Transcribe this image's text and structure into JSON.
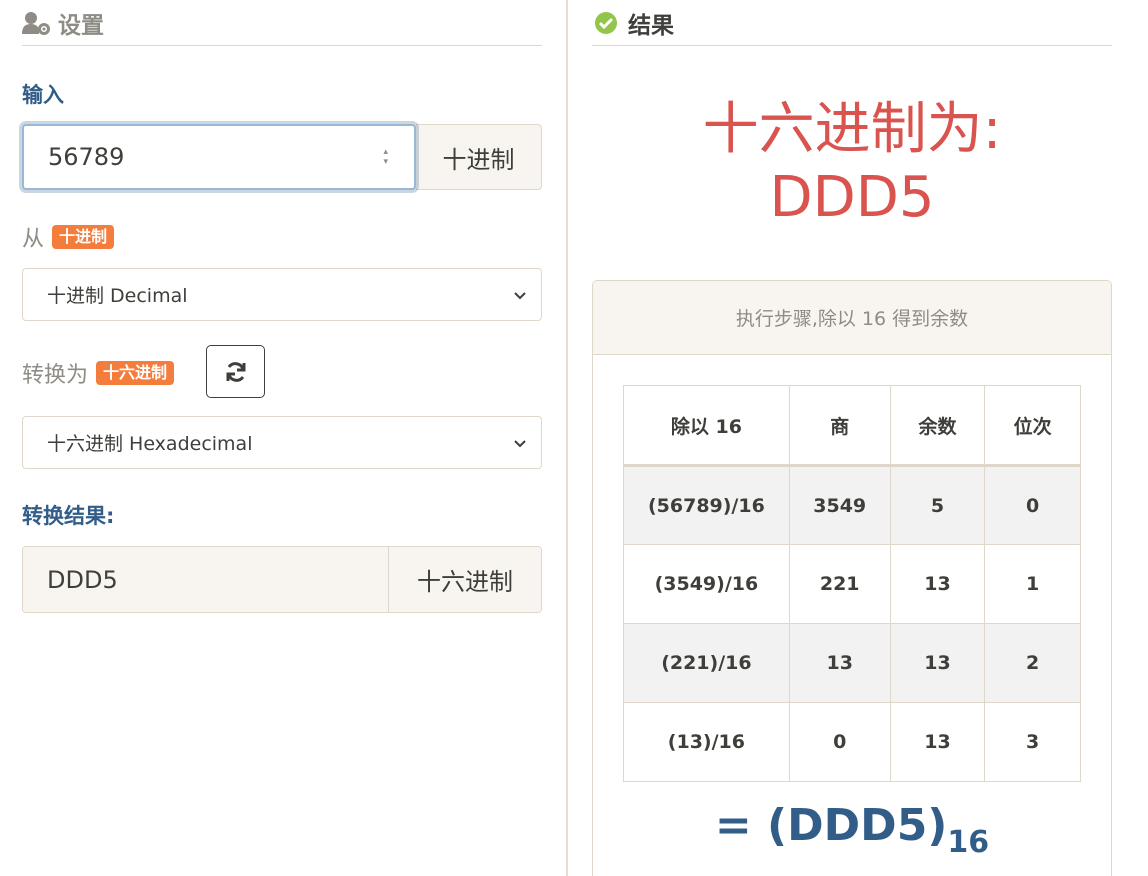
{
  "settings": {
    "title": "设置",
    "input_label": "输入",
    "input_value": "56789",
    "input_unit": "十进制",
    "from_label": "从",
    "from_badge": "十进制",
    "from_select": "十进制 Decimal",
    "to_label": "转换为",
    "to_badge": "十六进制",
    "to_select": "十六进制 Hexadecimal",
    "result_label": "转换结果:",
    "result_value": "DDD5",
    "result_unit": "十六进制"
  },
  "result": {
    "title": "结果",
    "heading_line1": "十六进制为:",
    "heading_line2": "DDD5",
    "steps_header": "执行步骤,除以 16 得到余数",
    "table": {
      "columns": [
        "除以 16",
        "商",
        "余数",
        "位次"
      ],
      "rows": [
        [
          "(56789)/16",
          "3549",
          "5",
          "0"
        ],
        [
          "(3549)/16",
          "221",
          "13",
          "1"
        ],
        [
          "(221)/16",
          "13",
          "13",
          "2"
        ],
        [
          "(13)/16",
          "0",
          "13",
          "3"
        ]
      ]
    },
    "final_value": "= (DDD5)",
    "final_base": "16"
  },
  "colors": {
    "accent_blue": "#325d88",
    "badge_orange": "#f47c3c",
    "result_red": "#d9534f",
    "success_green": "#93c54b"
  },
  "icons": [
    "user-gear-icon",
    "check-circle-icon",
    "sync-icon",
    "chevron-down-icon",
    "spinner-arrows-icon"
  ]
}
